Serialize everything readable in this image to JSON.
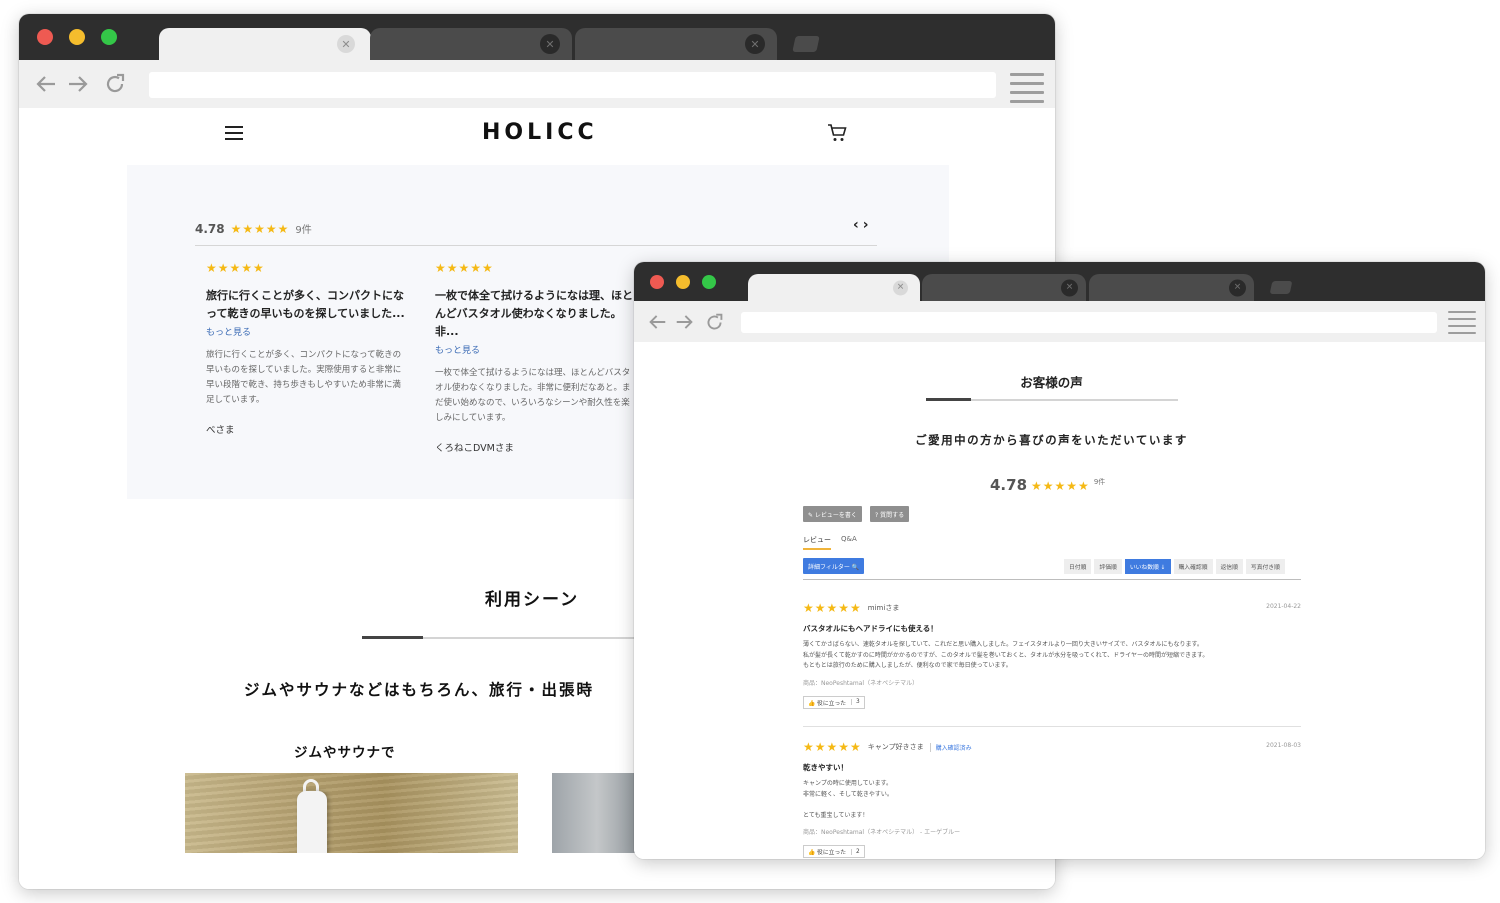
{
  "back_window": {
    "header": {
      "logo": "HOLICC",
      "menu_icon": "hamburger-icon",
      "cart_icon": "cart-icon"
    },
    "review_summary": {
      "score": "4.78",
      "stars": "★★★★★",
      "count": "9件",
      "prev": "‹",
      "next": "›"
    },
    "reviews": [
      {
        "stars": "★★★★★",
        "title": "旅行に行くことが多く、コンパクトになって乾きの早いものを探していました...",
        "more": "もっと見る",
        "body": "旅行に行くことが多く、コンパクトになって乾きの早いものを探していました。実際使用すると非常に早い段階で乾き、持ち歩きもしやすいため非常に満足しています。",
        "author": "べさま"
      },
      {
        "stars": "★★★★★",
        "title": "一枚で体全て拭けるようになは理、ほとんどバスタオル使わなくなりました。非...",
        "more": "もっと見る",
        "body": "一枚で体全て拭けるようになは理、ほとんどバスタオル使わなくなりました。非常に便利だなあと。まだ使い始めなので、いろいろなシーンや耐久性を楽しみにしています。",
        "author": "くろねこDVMさま"
      }
    ],
    "scene": {
      "title": "利用シーン",
      "subtitle": "ジムやサウナなどはもちろん、旅行・出張時",
      "item_title": "ジムやサウナで"
    }
  },
  "front_window": {
    "title": "お客様の声",
    "subtitle": "ご愛用中の方から喜びの声をいただいています",
    "summary": {
      "score": "4.78",
      "stars": "★★★★★",
      "count": "9件"
    },
    "buttons": {
      "write_review": "✎ レビューを書く",
      "ask_question": "? 質問する"
    },
    "tabs": {
      "review": "レビュー",
      "qa": "Q&A"
    },
    "filter_button": "詳細フィルター 🔍",
    "sort_options": [
      "日付順",
      "評価順",
      "いいね数順 ↓",
      "購入確認順",
      "返信順",
      "写真付き順"
    ],
    "reviews": [
      {
        "stars": "★★★★★",
        "name": "mimiさま",
        "badge": "",
        "date": "2021-04-22",
        "title": "バスタオルにもヘアドライにも使える！",
        "body": "薄くてかさばらない、速乾タオルを探していて、これだと思い購入しました。フェイスタオルより一回り大きいサイズで、バスタオルにもなります。\n私が髪が長くて乾かすのに時間がかかるのですが、このタオルで髪を巻いておくと、タオルが水分を吸ってくれて、ドライヤーの時間が短縮できます。\nもともとは旅行のために購入しましたが、便利なので家で毎日使っています。",
        "product": "商品：NeoPeshtamal（ネオペシテマル）",
        "helpful_label": "👍 役に立った",
        "helpful_count": "3"
      },
      {
        "stars": "★★★★★",
        "name": "キャンプ好きさま",
        "badge": "購入確認済み",
        "date": "2021-08-03",
        "title": "乾きやすい！",
        "body": "キャンプの時に使用しています。\n非常に軽く、そして乾きやすい。\n\nとても重宝しています！",
        "product": "商品：NeoPeshtamal（ネオペシテマル） - エーゲブルー",
        "helpful_label": "👍 役に立った",
        "helpful_count": "2"
      }
    ]
  }
}
